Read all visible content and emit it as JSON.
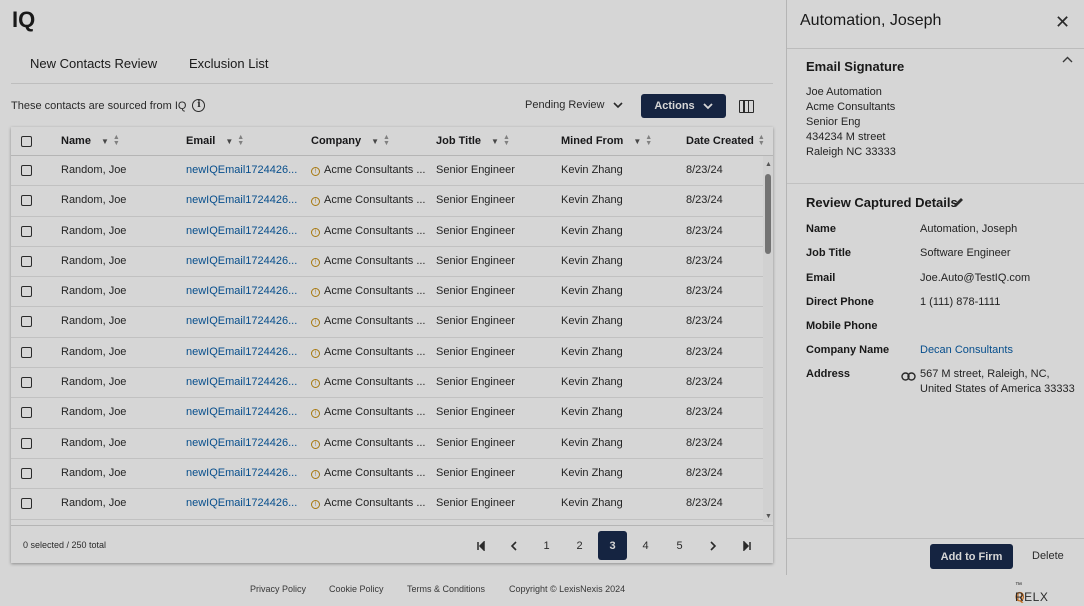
{
  "app": {
    "title": "IQ"
  },
  "tabs": [
    {
      "label": "New Contacts Review",
      "active": true
    },
    {
      "label": "Exclusion List",
      "active": false
    }
  ],
  "info_text": "These contacts are sourced from IQ",
  "filter_status": "Pending Review",
  "actions_label": "Actions",
  "table": {
    "columns": [
      "Name",
      "Email",
      "Company",
      "Job Title",
      "Mined From",
      "Date Created"
    ],
    "rows": [
      {
        "name": "Random, Joe",
        "email": "newIQEmail1724426...",
        "company": "Acme Consultants ...",
        "job_title": "Senior Engineer",
        "mined_from": "Kevin Zhang",
        "date_created": "8/23/24"
      },
      {
        "name": "Random, Joe",
        "email": "newIQEmail1724426...",
        "company": "Acme Consultants ...",
        "job_title": "Senior Engineer",
        "mined_from": "Kevin Zhang",
        "date_created": "8/23/24"
      },
      {
        "name": "Random, Joe",
        "email": "newIQEmail1724426...",
        "company": "Acme Consultants ...",
        "job_title": "Senior Engineer",
        "mined_from": "Kevin Zhang",
        "date_created": "8/23/24"
      },
      {
        "name": "Random, Joe",
        "email": "newIQEmail1724426...",
        "company": "Acme Consultants ...",
        "job_title": "Senior Engineer",
        "mined_from": "Kevin Zhang",
        "date_created": "8/23/24"
      },
      {
        "name": "Random, Joe",
        "email": "newIQEmail1724426...",
        "company": "Acme Consultants ...",
        "job_title": "Senior Engineer",
        "mined_from": "Kevin Zhang",
        "date_created": "8/23/24"
      },
      {
        "name": "Random, Joe",
        "email": "newIQEmail1724426...",
        "company": "Acme Consultants ...",
        "job_title": "Senior Engineer",
        "mined_from": "Kevin Zhang",
        "date_created": "8/23/24"
      },
      {
        "name": "Random, Joe",
        "email": "newIQEmail1724426...",
        "company": "Acme Consultants ...",
        "job_title": "Senior Engineer",
        "mined_from": "Kevin Zhang",
        "date_created": "8/23/24"
      },
      {
        "name": "Random, Joe",
        "email": "newIQEmail1724426...",
        "company": "Acme Consultants ...",
        "job_title": "Senior Engineer",
        "mined_from": "Kevin Zhang",
        "date_created": "8/23/24"
      },
      {
        "name": "Random, Joe",
        "email": "newIQEmail1724426...",
        "company": "Acme Consultants ...",
        "job_title": "Senior Engineer",
        "mined_from": "Kevin Zhang",
        "date_created": "8/23/24"
      },
      {
        "name": "Random, Joe",
        "email": "newIQEmail1724426...",
        "company": "Acme Consultants ...",
        "job_title": "Senior Engineer",
        "mined_from": "Kevin Zhang",
        "date_created": "8/23/24"
      },
      {
        "name": "Random, Joe",
        "email": "newIQEmail1724426...",
        "company": "Acme Consultants ...",
        "job_title": "Senior Engineer",
        "mined_from": "Kevin Zhang",
        "date_created": "8/23/24"
      },
      {
        "name": "Random, Joe",
        "email": "newIQEmail1724426...",
        "company": "Acme Consultants ...",
        "job_title": "Senior Engineer",
        "mined_from": "Kevin Zhang",
        "date_created": "8/23/24"
      }
    ],
    "selection_summary": "0 selected / 250 total"
  },
  "pagination": {
    "pages": [
      "1",
      "2",
      "3",
      "4",
      "5"
    ],
    "current": "3"
  },
  "footer": {
    "links": [
      "Privacy Policy",
      "Cookie Policy",
      "Terms & Conditions"
    ],
    "copyright": "Copyright © LexisNexis 2024",
    "brand": "RELX",
    "brand_tm": "™"
  },
  "panel": {
    "title": "Automation, Joseph",
    "email_signature": {
      "heading": "Email Signature",
      "lines": [
        "Joe Automation",
        "Acme Consultants",
        "Senior Eng",
        "434234 M street",
        "Raleigh NC 33333"
      ]
    },
    "review": {
      "heading": "Review Captured Details",
      "fields": [
        {
          "label": "Name",
          "value": "Automation, Joseph"
        },
        {
          "label": "Job Title",
          "value": "Software Engineer"
        },
        {
          "label": "Email",
          "value": "Joe.Auto@TestIQ.com"
        },
        {
          "label": "Direct Phone",
          "value": "1 (111) 878-1111"
        },
        {
          "label": "Mobile Phone",
          "value": ""
        },
        {
          "label": "Company Name",
          "value": "Decan Consultants"
        },
        {
          "label": "Address",
          "value": "567 M street, Raleigh, NC,",
          "value2": "United States of America 33333"
        }
      ]
    },
    "add_label": "Add to Firm",
    "delete_label": "Delete"
  },
  "colors": {
    "navy": "#1a2b4e",
    "accent_red": "#c6151b",
    "link_blue": "#0a5fa8",
    "overlay": "rgba(0,0,0,0.16)"
  }
}
